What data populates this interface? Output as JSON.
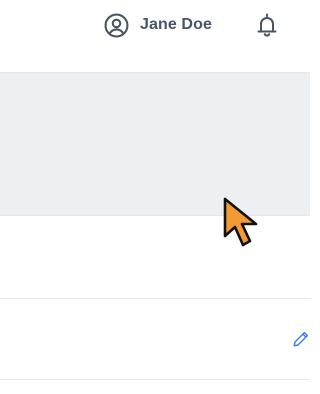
{
  "header": {
    "user_name": "Jane Doe",
    "user_icon": "user-circle-icon",
    "notification_icon": "bell-icon"
  },
  "rows": [
    {
      "edit_icon": "pencil-icon"
    }
  ],
  "cursor": {
    "icon": "mouse-pointer-icon"
  },
  "colors": {
    "text": "#475569",
    "highlight_row": "#edf0f3",
    "divider": "#e5e7eb",
    "accent_link": "#3b82f6",
    "cursor_fill": "#f39a34"
  }
}
